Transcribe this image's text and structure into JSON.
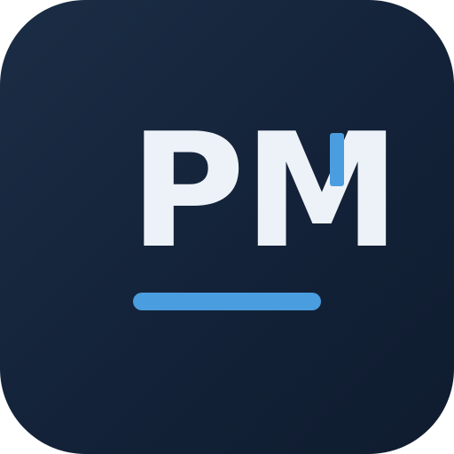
{
  "logo": {
    "monogram": "PM",
    "colors": {
      "tile": "#16263d",
      "text": "#edf2f8",
      "accent": "#4a9ddf"
    },
    "shapes": [
      "cursor-tick",
      "underline-bar"
    ]
  }
}
